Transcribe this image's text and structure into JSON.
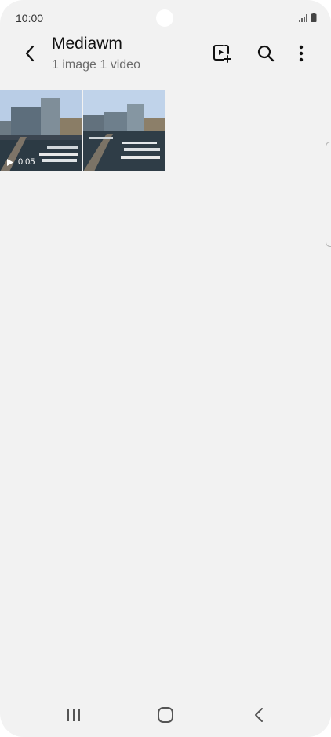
{
  "status_bar": {
    "time": "10:00",
    "icons": [
      "signal-icon",
      "battery-icon"
    ]
  },
  "app_bar": {
    "title": "Mediawm",
    "subtitle": "1 image 1 video",
    "actions": [
      "create-icon",
      "search-icon",
      "more-options-icon"
    ]
  },
  "media": {
    "items": [
      {
        "type": "video",
        "duration": "0:05"
      },
      {
        "type": "image"
      }
    ]
  },
  "nav_bar": {
    "buttons": [
      "recent-apps-icon",
      "home-icon",
      "back-icon"
    ]
  },
  "colors": {
    "background": "#f2f2f2",
    "text_primary": "#111111",
    "text_secondary": "#6b6b6b"
  }
}
